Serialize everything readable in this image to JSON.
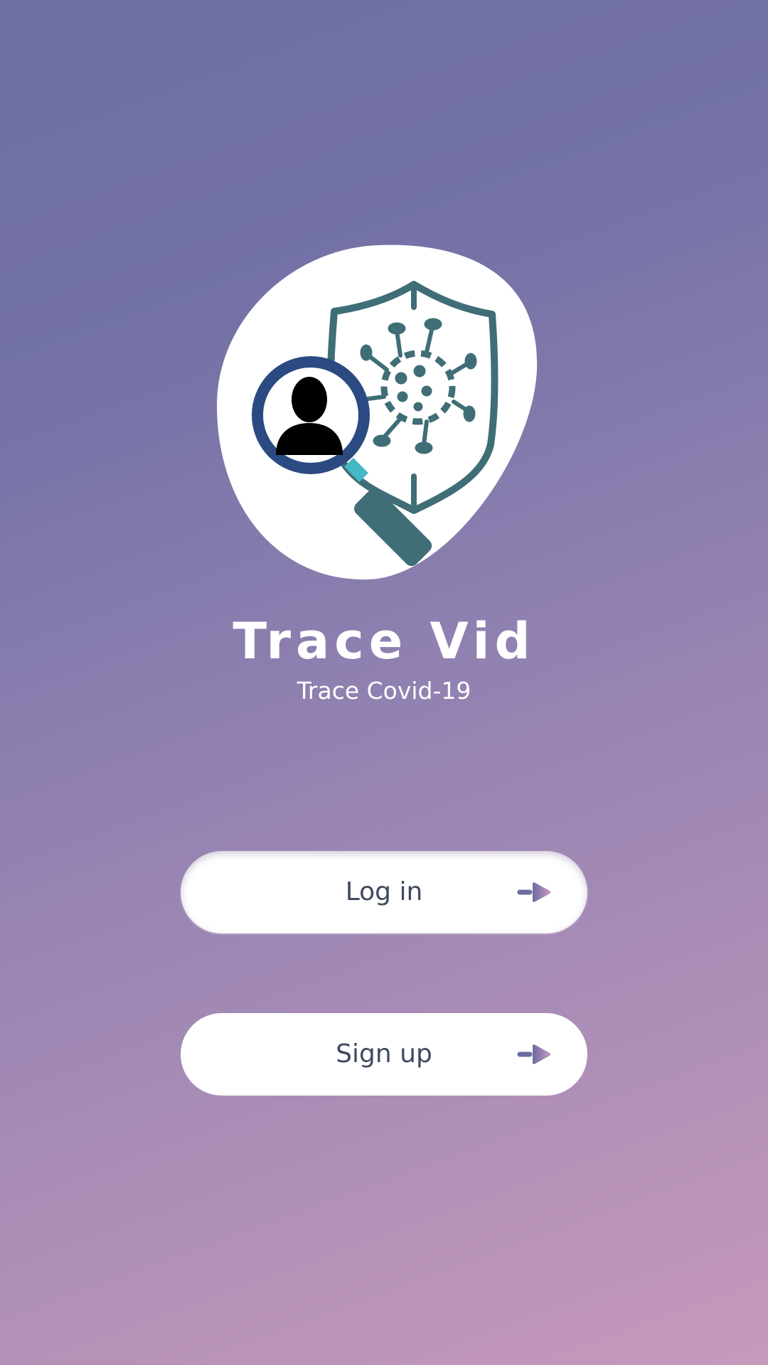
{
  "app": {
    "title": "Trace Vid",
    "subtitle": "Trace Covid-19"
  },
  "logo": {
    "icon": "shield-virus-magnifier-person-icon",
    "colors": {
      "blob": "#ffffff",
      "shield": "#3f6e76",
      "virus": "#3f6e76",
      "magnifier_ring": "#2b4a82",
      "magnifier_neck": "#45b8c6",
      "magnifier_handle": "#3f6e76",
      "person": "#000000"
    }
  },
  "buttons": {
    "login_label": "Log in",
    "signup_label": "Sign up",
    "arrow_icon": "arrow-right-icon"
  },
  "colors": {
    "background_top": "#6e6ea4",
    "background_bottom": "#c799bb",
    "button_bg": "#ffffff",
    "button_text": "#3f4a60",
    "arrow_start": "#6c6ca2",
    "arrow_end": "#c99ac0"
  }
}
